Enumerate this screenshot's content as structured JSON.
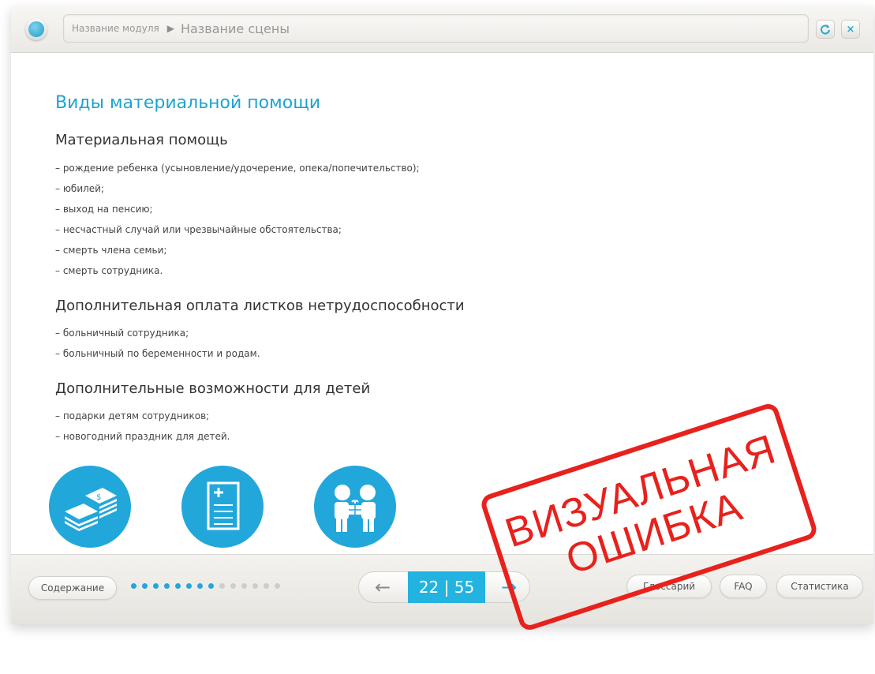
{
  "topbar": {
    "module": "Название модуля",
    "separator": "▶",
    "scene": "Название сцены",
    "reload_label": "C",
    "close_label": "×"
  },
  "content": {
    "title": "Виды материальной помощи",
    "sections": [
      {
        "heading": "Материальная помощь",
        "items": [
          "– рождение ребенка (усыновление/удочерение, опека/попечительство);",
          "– юбилей;",
          "– выход на пенсию;",
          "– несчастный случай или чрезвычайные обстоятельства;",
          "– смерть члена семьи;",
          "– смерть сотрудника."
        ]
      },
      {
        "heading": "Дополнительная оплата листков нетрудоспособности",
        "items": [
          "– больничный сотрудника;",
          "– больничный по беременности и родам."
        ]
      },
      {
        "heading": "Дополнительные возможности для детей",
        "items": [
          "– подарки детям сотрудников;",
          "– новогодний праздник для детей."
        ]
      }
    ],
    "icons": [
      "money-stack-icon",
      "document-plus-icon",
      "children-gift-icon"
    ]
  },
  "bottombar": {
    "contents_label": "Содержание",
    "progress": {
      "completed": 8,
      "total": 14
    },
    "counter": "22 | 55",
    "prev_icon": "arrow-left-icon",
    "next_icon": "arrow-right-icon",
    "glossary_label": "Глоссарий",
    "faq_label": "FAQ",
    "stats_label": "Статистика"
  },
  "stamp": {
    "line1": "ВИЗУАЛЬНАЯ",
    "line2": "ОШИБКА",
    "color": "#e8211c"
  },
  "colors": {
    "accent": "#22a7db",
    "title": "#1fa3d0"
  }
}
